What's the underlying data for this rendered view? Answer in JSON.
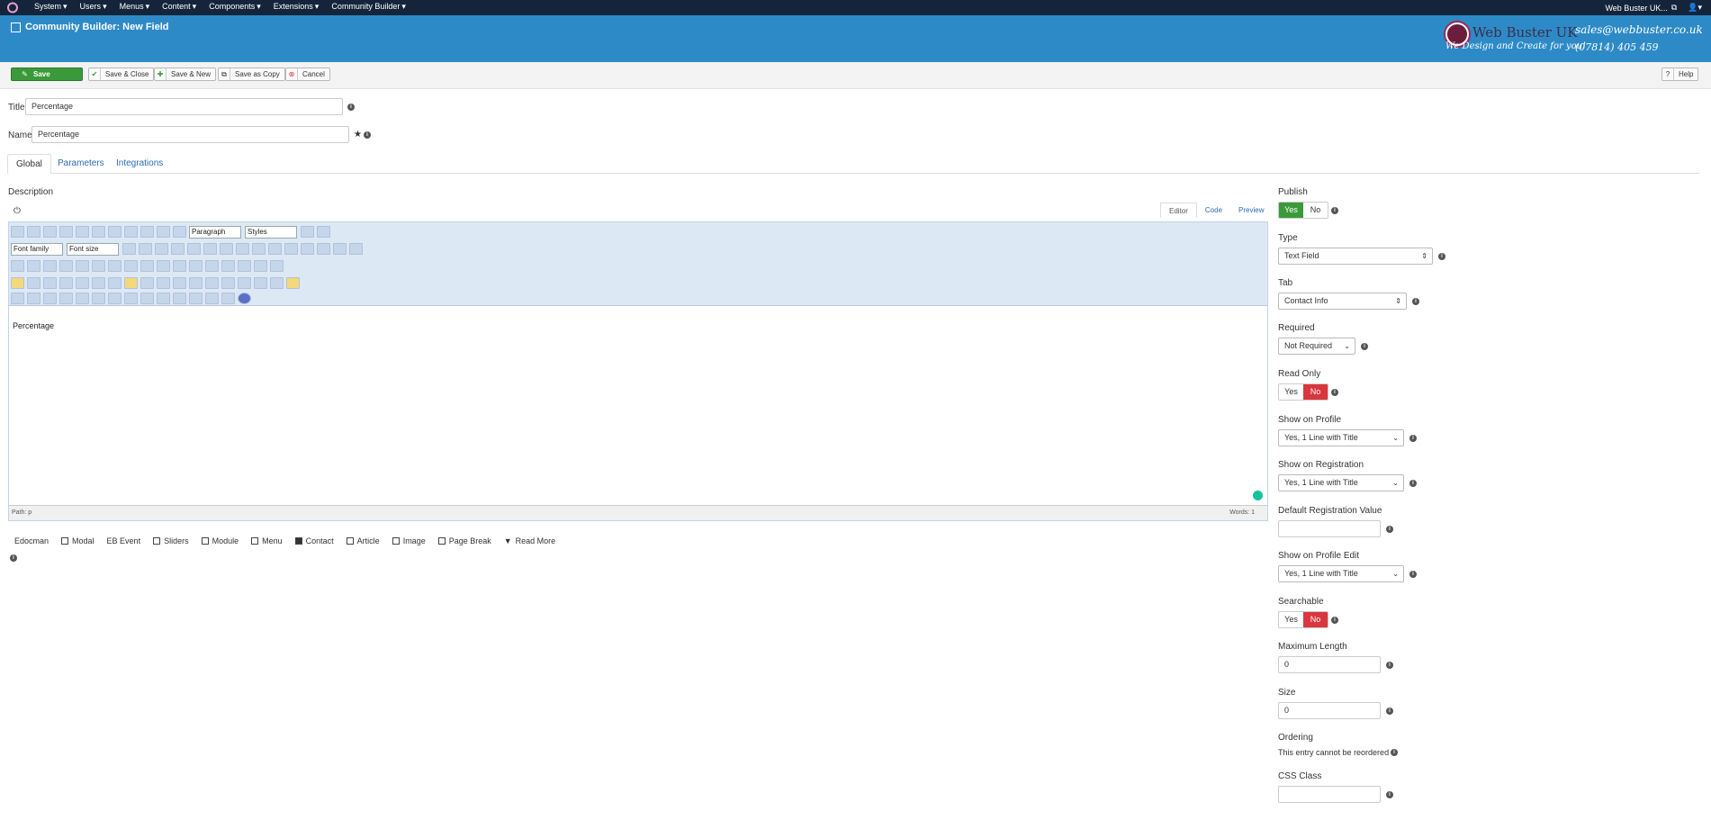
{
  "topbar": {
    "menu": [
      "System",
      "Users",
      "Menus",
      "Content",
      "Components",
      "Extensions",
      "Community Builder"
    ],
    "site_name": "Web Buster UK..."
  },
  "header": {
    "title": "Community Builder: New Field",
    "brand_name": "Web Buster UK",
    "brand_email": "sales@webbuster.co.uk",
    "brand_tagline": "We Design and Create for you!",
    "brand_phone": "(07814) 405 459"
  },
  "toolbar": {
    "save": "Save",
    "save_close": "Save & Close",
    "save_new": "Save & New",
    "save_copy": "Save as Copy",
    "cancel": "Cancel",
    "help": "Help"
  },
  "form": {
    "title_label": "Title",
    "title_value": "Percentage",
    "name_label": "Name",
    "name_value": "Percentage"
  },
  "tabs": [
    "Global",
    "Parameters",
    "Integrations"
  ],
  "editor": {
    "description_label": "Description",
    "modes": [
      "Editor",
      "Code",
      "Preview"
    ],
    "format_select": "Paragraph",
    "styles_select": "Styles",
    "font_family": "Font family",
    "font_size": "Font size",
    "content": "Percentage",
    "path": "Path: p",
    "words": "Words: 1"
  },
  "extra_buttons": [
    "Edocman",
    "Modal",
    "EB Event",
    "Sliders",
    "Module",
    "Menu",
    "Contact",
    "Article",
    "Image",
    "Page Break",
    "Read More"
  ],
  "right": {
    "publish_label": "Publish",
    "publish_yes": "Yes",
    "publish_no": "No",
    "type_label": "Type",
    "type_value": "Text Field",
    "tab_label": "Tab",
    "tab_value": "Contact Info",
    "required_label": "Required",
    "required_value": "Not Required",
    "readonly_label": "Read Only",
    "readonly_yes": "Yes",
    "readonly_no": "No",
    "show_profile_label": "Show on Profile",
    "show_profile_value": "Yes, 1 Line with Title",
    "show_reg_label": "Show on Registration",
    "show_reg_value": "Yes, 1 Line with Title",
    "default_reg_label": "Default Registration Value",
    "default_reg_value": "",
    "show_edit_label": "Show on Profile Edit",
    "show_edit_value": "Yes, 1 Line with Title",
    "searchable_label": "Searchable",
    "searchable_yes": "Yes",
    "searchable_no": "No",
    "maxlen_label": "Maximum Length",
    "maxlen_value": "0",
    "size_label": "Size",
    "size_value": "0",
    "ordering_label": "Ordering",
    "ordering_text": "This entry cannot be reordered",
    "css_label": "CSS Class",
    "css_value": ""
  },
  "colors": {
    "topbar": "#14253b",
    "header": "#2d8ac7",
    "save_green": "#3a9a3a",
    "no_red": "#d9363e",
    "link_blue": "#2a6bb5"
  }
}
